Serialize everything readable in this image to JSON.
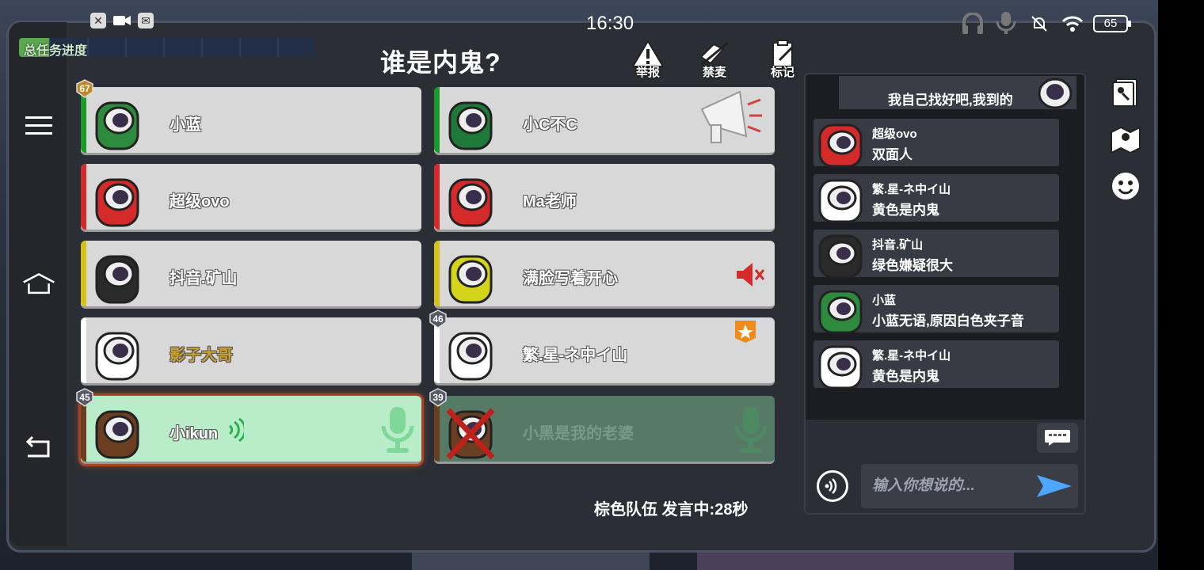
{
  "status_bar": {
    "time": "16:30",
    "battery": "65"
  },
  "task_progress": {
    "label": "总任务进度"
  },
  "title": "谁是内鬼?",
  "actions": {
    "report": "举报",
    "mute": "禁麦",
    "mark": "标记"
  },
  "players": [
    {
      "name": "小蓝",
      "color": "#2e8b3e",
      "stripe": "#1a9a2a",
      "level": "67"
    },
    {
      "name": "小C不C",
      "color": "#1f7a3a",
      "stripe": "#1a9a2a"
    },
    {
      "name": "超级ovo",
      "color": "#d42a2a",
      "stripe": "#d42a2a"
    },
    {
      "name": "Ma老师",
      "color": "#d42a2a",
      "stripe": "#d42a2a"
    },
    {
      "name": "抖音.矿山",
      "color": "#2a2a2a",
      "stripe": "#d4c21a"
    },
    {
      "name": "满脸写着开心",
      "color": "#d4d41a",
      "stripe": "#d4c21a"
    },
    {
      "name": "影子大哥",
      "color": "#ffffff",
      "stripe": "#ffffff",
      "name_color": "#c8a030"
    },
    {
      "name": "繁.星-ネ中イ山",
      "color": "#ffffff",
      "stripe": "#ffffff",
      "level": "46"
    },
    {
      "name": "小ikun",
      "color": "#6b3e22",
      "stripe": "#6b3e22",
      "level": "45"
    },
    {
      "name": "小黑是我的老婆",
      "color": "#6b3e22",
      "stripe": "#6b3e22",
      "level": "39"
    }
  ],
  "speaking": "棕色队伍 发言中:28秒",
  "chat": {
    "top_message": "我自己找好吧,我到的",
    "messages": [
      {
        "who": "超级ovo",
        "text": "双面人"
      },
      {
        "who": "繁.星-ネ中イ山",
        "text": "黄色是内鬼"
      },
      {
        "who": "抖音.矿山",
        "text": "绿色嫌疑很大"
      },
      {
        "who": "小蓝",
        "text": "小蓝无语,原因白色夹子音"
      },
      {
        "who": "繁.星-ネ中イ山",
        "text": "黄色是内鬼"
      }
    ],
    "input_placeholder": "输入你想说的..."
  }
}
